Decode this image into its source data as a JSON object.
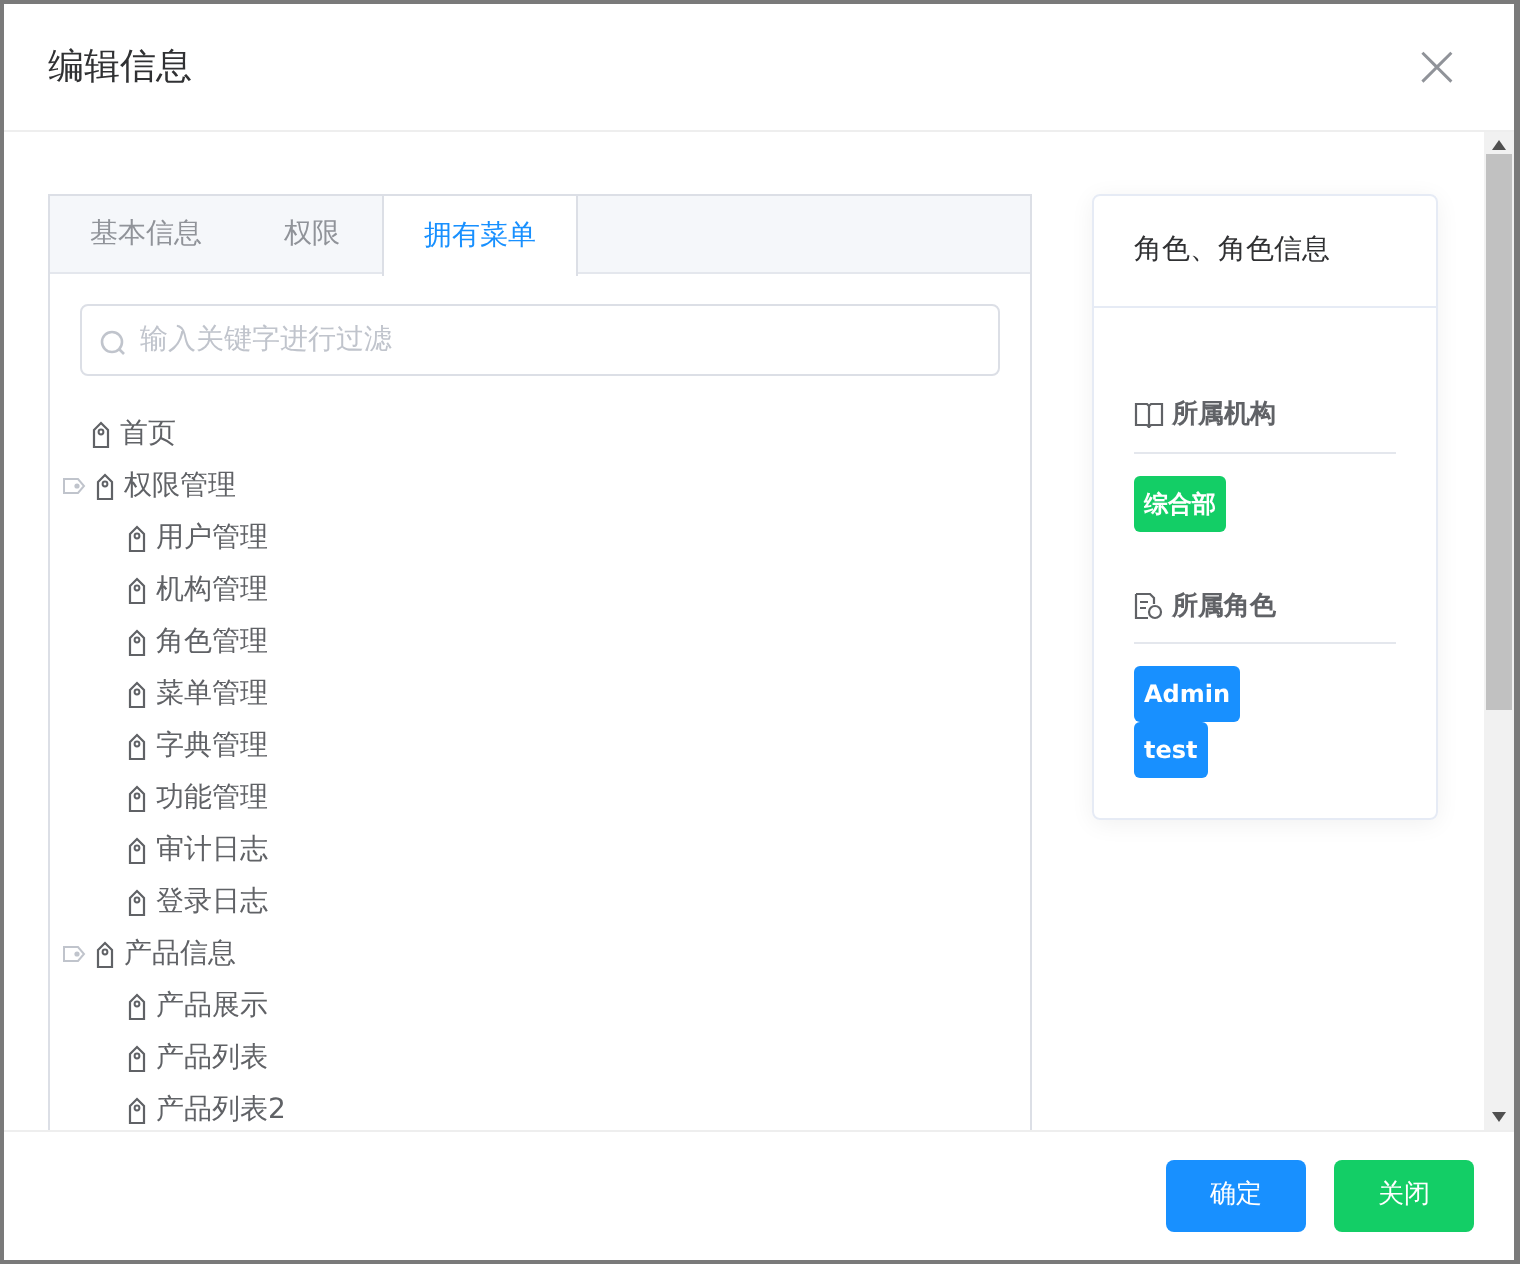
{
  "dialog": {
    "title": "编辑信息",
    "close": "×"
  },
  "tabs": [
    {
      "label": "基本信息",
      "selected": false
    },
    {
      "label": "权限",
      "selected": false
    },
    {
      "label": "拥有菜单",
      "selected": true
    }
  ],
  "filter": {
    "placeholder": "输入关键字进行过滤"
  },
  "tree": [
    {
      "label": "首页"
    },
    {
      "label": "权限管理",
      "expanded": true,
      "children": [
        {
          "label": "用户管理"
        },
        {
          "label": "机构管理"
        },
        {
          "label": "角色管理"
        },
        {
          "label": "菜单管理"
        },
        {
          "label": "字典管理"
        },
        {
          "label": "功能管理"
        },
        {
          "label": "审计日志"
        },
        {
          "label": "登录日志"
        }
      ]
    },
    {
      "label": "产品信息",
      "expanded": true,
      "children": [
        {
          "label": "产品展示"
        },
        {
          "label": "产品列表"
        },
        {
          "label": "产品列表2"
        }
      ]
    }
  ],
  "info_card": {
    "title": "角色、角色信息",
    "sections": [
      {
        "kind": "org",
        "heading": "所属机构",
        "tags": [
          {
            "label": "综合部",
            "color": "#13ce66"
          }
        ]
      },
      {
        "kind": "role",
        "heading": "所属角色",
        "tags": [
          {
            "label": "Admin",
            "color": "#1890ff"
          },
          {
            "label": "test",
            "color": "#1890ff"
          }
        ]
      }
    ]
  },
  "buttons": [
    {
      "label": "确定",
      "color": "#1890ff"
    },
    {
      "label": "关闭",
      "color": "#13ce66"
    }
  ]
}
